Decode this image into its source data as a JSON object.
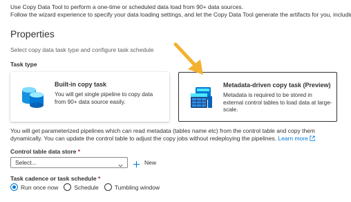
{
  "intro": {
    "line1": "Use Copy Data Tool to perform a one-time or scheduled data load from 90+ data sources.",
    "line2": "Follow the wizard experience to specify your data loading settings, and let the Copy Data Tool generate the artifacts for you, including pip"
  },
  "section_title": "Properties",
  "subtitle": "Select copy data task type and configure task schedule",
  "task_type": {
    "label": "Task type",
    "cards": [
      {
        "title": "Built-in copy task",
        "description": "You will get single pipeline to copy data from 90+ data source easily.",
        "icon": "database-cylinders-icon",
        "selected": false
      },
      {
        "title": "Metadata-driven copy task (Preview)",
        "description": "Metadata is required to be stored in external control tables to load data at large-scale.",
        "icon": "metadata-table-icon",
        "selected": true
      }
    ]
  },
  "parameterized": {
    "text": "You will get parameterized pipelines which can read metadata (tables name etc) from the control table and copy them dynamically. You can update the control table to adjust the copy jobs without redeploying the pipelines.",
    "link": "Learn more",
    "link_icon": "external-link-icon"
  },
  "control_table": {
    "label": "Control table data store",
    "required_mark": "*",
    "value": "Select...",
    "new_label": "New"
  },
  "schedule": {
    "label": "Task cadence or task schedule",
    "required_mark": "*",
    "options": [
      "Run once now",
      "Schedule",
      "Tumbling window"
    ],
    "selected_index": 0
  },
  "colors": {
    "accent": "#0078d4",
    "arrow": "#f2b230",
    "required": "#a4262c"
  }
}
